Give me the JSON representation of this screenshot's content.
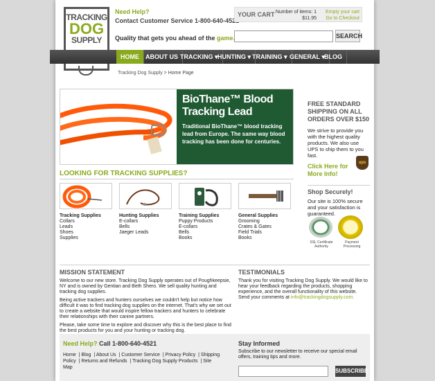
{
  "header": {
    "logo": {
      "line1": "TRACKING",
      "line2": "DOG",
      "line3": "SUPPLY"
    },
    "need_help": "Need Help?",
    "contact": "Contact Customer Service 1-800-640-4521",
    "tagline_pre": "Quality that gets you ahead of the ",
    "tagline_em": "game."
  },
  "cart": {
    "title": "YOUR CART",
    "items_label": "Number of items:  1",
    "total": "$11.95",
    "empty_link": "Empty your cart",
    "checkout_link": "Go to Checkout"
  },
  "search": {
    "placeholder": "",
    "button": "SEARCH"
  },
  "nav": [
    {
      "label": "HOME"
    },
    {
      "label": "ABOUT US"
    },
    {
      "label": "TRACKING ▾"
    },
    {
      "label": "HUNTING ▾"
    },
    {
      "label": "TRAINING ▾"
    },
    {
      "label": "GENERAL ▾"
    },
    {
      "label": "BLOG"
    }
  ],
  "breadcrumb": {
    "link": "Tracking Dog Supply",
    "current": " > Home Page"
  },
  "hero": {
    "title": "BioThane™ Blood Tracking Lead",
    "body": "Traditional BioThane™ blood tracking lead from Europe. The same way blood tracking has been done for centuries."
  },
  "looking": "LOOKING FOR TRACKING SUPPLIES?",
  "categories": [
    {
      "title": "Tracking Supplies",
      "items": [
        "Collars",
        "Leads",
        "Shoes",
        "Supplies"
      ]
    },
    {
      "title": "Hunting Supplies",
      "items": [
        "E-collars",
        "Bells",
        "Jaeger Leads"
      ]
    },
    {
      "title": "Training Supplies",
      "items": [
        "Puppy Products",
        "E-collars",
        "Bells",
        "Books"
      ]
    },
    {
      "title": "General Supplies",
      "items": [
        "Grooming",
        "Crates & Gates",
        "Field Trials",
        "Books"
      ]
    }
  ],
  "sidebar": {
    "shipping_h": "FREE STANDARD SHIPPING ON ALL ORDERS OVER $150",
    "shipping_t": "We strive to provide you with the highest quality products. We also use UPS to ship them to you fast.",
    "click_here": "Click Here for More Info!",
    "ups": "ups",
    "secure_h": "Shop Securely!",
    "secure_t": "Our site is 100% secure and your satisfaction is guaranteed.",
    "ssl_caption": "SSL Certificate Authority",
    "auth_caption": "Payment Processing"
  },
  "mission": {
    "heading": "MISSION STATEMENT",
    "p1": "Welcome to our new store. Tracking Dog Supply operates out of Poughkeepsie, NY and is owned by Gentian and Beth Shero. We sell quality hunting and tracking dog supplies.",
    "p2": "Being active trackers and hunters ourselves we couldn't help but notice how difficult it was to find tracking dog supplies on the internet. That's why we set out to create a website that would inspire fellow trackers and hunters to celebrate their relationships with their canine partners.",
    "p3": "Please, take some time to explore and discover why this is the best place to find the best products for you and your hunting or tracking dog."
  },
  "testimonials": {
    "heading": "TESTIMONIALS",
    "text": "Thank you for visiting Tracking Dog Supply. We would like to hear your feedback regarding the products, shopping experience, and the overall functionality of this website. Send your comments at ",
    "email": "info@trackingdogsupply.com."
  },
  "footer": {
    "need_help": "Need Help?",
    "call": " Call 1-800-640-4521",
    "links": [
      "Home",
      "Blog",
      "About Us",
      "Customer Service",
      "Privacy Policy",
      "Shipping Policy",
      "Returns and Refunds",
      "Tracking Dog Supply Products",
      "Site Map"
    ],
    "stay_h": "Stay Informed",
    "stay_t": "Subscribe to our newsletter to receive our special email offers, training tips and more.",
    "subscribe": "SUBSCRIBE"
  },
  "colors": {
    "accent": "#8aaa1e",
    "hero_bg": "#1f5a33",
    "nav_bg": "#333333",
    "lead_orange": "#ff5a0a"
  }
}
